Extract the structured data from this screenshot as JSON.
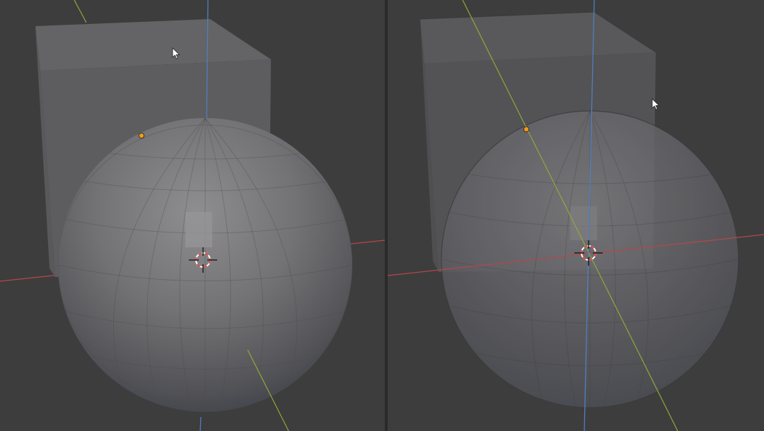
{
  "colors": {
    "background": "#3d3d3d",
    "x_axis": "#b5484a",
    "y_axis": "#8fa93a",
    "z_axis": "#4f7fbf",
    "origin_point": "#f29a1a",
    "cursor_ring_red": "#e0463e",
    "cursor_ring_white": "#ffffff",
    "cube_front": "#5c5b5e",
    "cube_top": "#646366",
    "sphere_light": "#8a898c",
    "sphere_dark": "#3a3d44"
  },
  "viewports": [
    {
      "id": "left",
      "shading": "solid",
      "xray": false,
      "icons": [
        "3d-cursor-icon",
        "mouse-pointer-icon",
        "object-origin-icon"
      ]
    },
    {
      "id": "right",
      "shading": "solid",
      "xray": true,
      "icons": [
        "3d-cursor-icon",
        "mouse-pointer-icon",
        "object-origin-icon"
      ]
    }
  ]
}
